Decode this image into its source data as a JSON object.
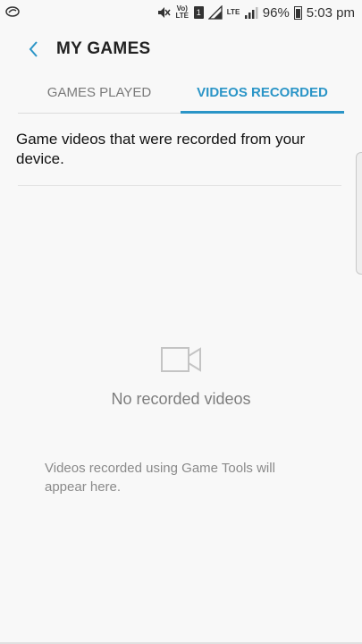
{
  "status_bar": {
    "lte_label_1": "Vo) LTE",
    "lte_label_2": "LTE",
    "sim_label": "1",
    "battery": "96%",
    "time": "5:03 pm"
  },
  "header": {
    "title": "MY GAMES"
  },
  "tabs": [
    {
      "label": "GAMES PLAYED",
      "active": false
    },
    {
      "label": "VIDEOS RECORDED",
      "active": true
    }
  ],
  "main": {
    "description": "Game videos that were recorded from your device.",
    "empty_title": "No recorded videos",
    "empty_subtitle": "Videos recorded using Game Tools will appear here."
  },
  "colors": {
    "accent": "#2b95c7",
    "background": "#f8f8f8"
  },
  "icons": {
    "back": "back-arrow-icon",
    "empty": "video-camera-icon"
  }
}
